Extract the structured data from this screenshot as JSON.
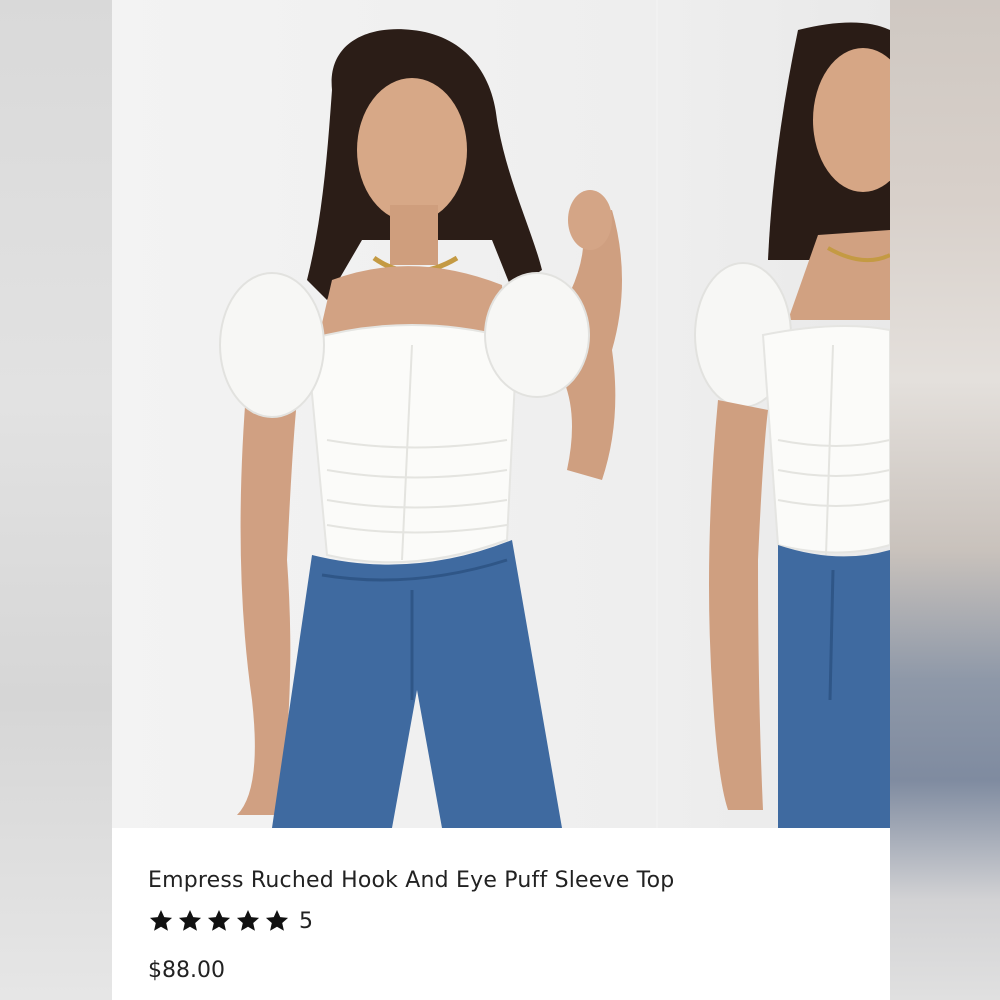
{
  "product": {
    "title": "Empress Ruched Hook And Eye Puff Sleeve Top",
    "rating": {
      "stars": 5,
      "count_text": "5"
    },
    "price": "$88.00"
  },
  "colors": {
    "card_background": "#ffffff",
    "text": "#222222",
    "star": "#111111"
  },
  "icons": {
    "star": "star-icon"
  }
}
